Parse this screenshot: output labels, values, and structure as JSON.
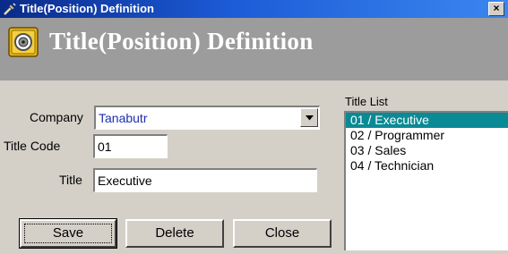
{
  "window": {
    "title": "Title(Position) Definition",
    "close_glyph": "×"
  },
  "header": {
    "title": "Title(Position) Definition"
  },
  "form": {
    "company_label": "Company",
    "company_value": "Tanabutr",
    "title_code_label": "Title Code",
    "title_code_value": "01",
    "title_label": "Title",
    "title_value": "Executive"
  },
  "buttons": {
    "save": "Save",
    "delete": "Delete",
    "close": "Close"
  },
  "title_list": {
    "label": "Title List",
    "items": [
      "01 / Executive",
      "02 / Programmer",
      "03 / Sales",
      "04 / Technician"
    ],
    "selected_index": 0
  },
  "colors": {
    "selection": "#0a8a94",
    "title_gradient_start": "#0a2a8a",
    "title_gradient_end": "#3b86f0",
    "header_bg": "#9c9c9c"
  },
  "icons": {
    "window": "tools-icon",
    "header": "safe-icon",
    "dropdown": "chevron-down-icon"
  }
}
